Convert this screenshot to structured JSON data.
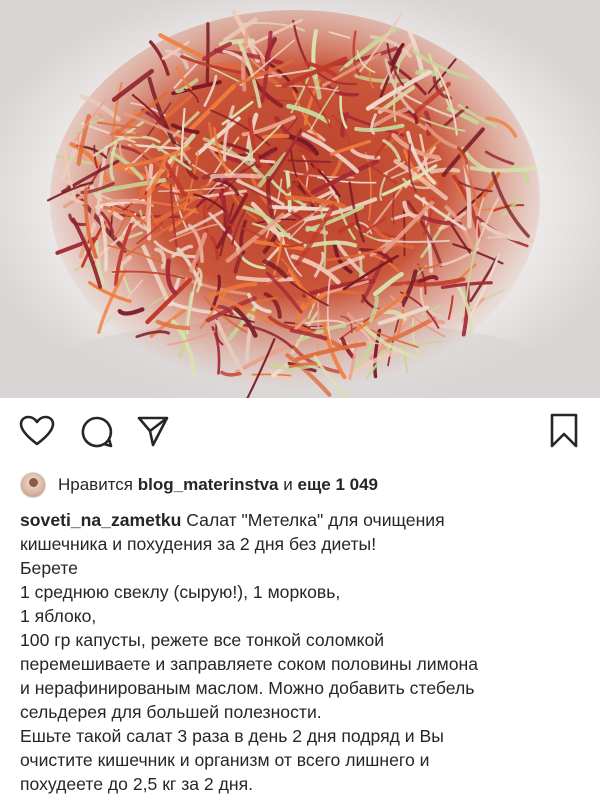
{
  "post": {
    "image_alt": "",
    "icons": {
      "like": "heart-icon",
      "comment": "comment-icon",
      "share": "paper-plane-icon",
      "save": "bookmark-icon"
    }
  },
  "likes": {
    "prefix": "Нравится",
    "user": "blog_materinstva",
    "conj": "и",
    "others": "еще 1 049"
  },
  "caption": {
    "username": "soveti_na_zametku",
    "lines": [
      "Салат \"Метелка\" для очищения",
      "кишечника и похудения за 2 дня без диеты!",
      "Берете",
      "1 среднюю свеклу (сырую!), 1 морковь,",
      "1 яблоко,",
      "100 гр капусты, режете все тонкой соломкой",
      "перемешиваете и заправляете соком половины лимона",
      "и нерафинированым маслом. Можно добавить стебель",
      "сельдерея для большей полезности.",
      "Ешьте такой салат 3 раза в день 2 дня подряд и Вы",
      "очистите кишечник и организм от всего лишнего и",
      "похудеете до 2,5 кг за 2 дня."
    ]
  }
}
